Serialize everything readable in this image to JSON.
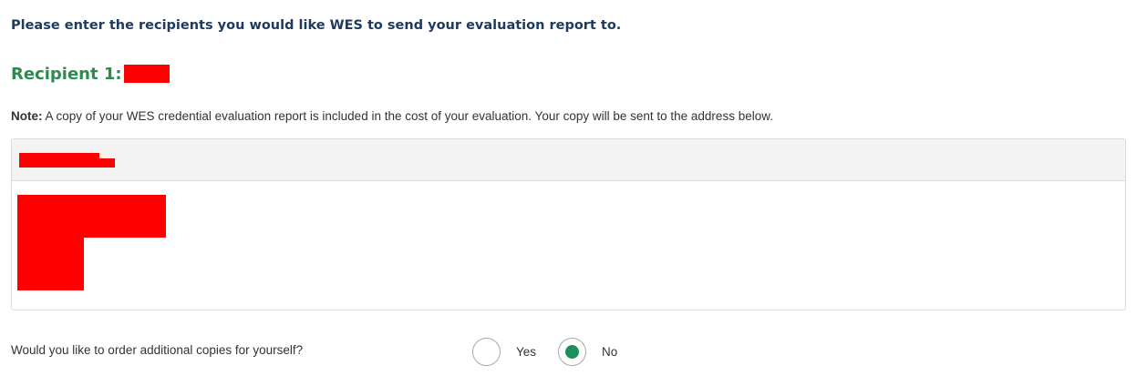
{
  "intro_text": "Please enter the recipients you would like WES to send your evaluation report to.",
  "recipient": {
    "heading": "Recipient 1:"
  },
  "note": {
    "label": "Note:",
    "text": " A copy of your WES credential evaluation report is included in the cost of your evaluation. Your copy will be sent to the address below."
  },
  "additional_copies": {
    "question": "Would you like to order additional copies for yourself?",
    "options": [
      {
        "label": "Yes",
        "selected": false
      },
      {
        "label": "No",
        "selected": true
      }
    ]
  },
  "colors": {
    "heading_navy": "#1e3a5f",
    "recipient_green": "#2e8b4e",
    "radio_selected": "#1e8f5a",
    "redaction": "#ff0000"
  }
}
